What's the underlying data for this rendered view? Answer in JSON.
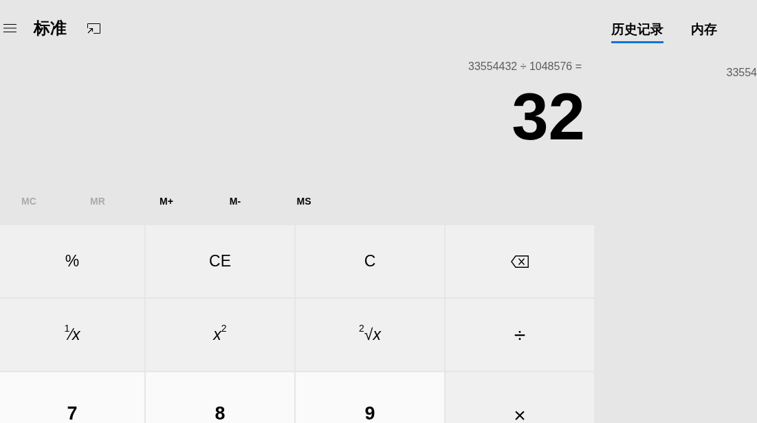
{
  "header": {
    "mode_title": "标准"
  },
  "display": {
    "expression": "33554432 ÷ 1048576 =",
    "result": "32"
  },
  "memory_buttons": [
    {
      "label": "MC",
      "disabled": true
    },
    {
      "label": "MR",
      "disabled": true
    },
    {
      "label": "M+",
      "disabled": false
    },
    {
      "label": "M-",
      "disabled": false
    },
    {
      "label": "MS",
      "disabled": false
    }
  ],
  "keys": [
    {
      "kind": "function",
      "label": "%"
    },
    {
      "kind": "function",
      "label": "CE"
    },
    {
      "kind": "function",
      "label": "C"
    },
    {
      "kind": "backspace"
    },
    {
      "kind": "function",
      "label": "$^{1}$⁄*x*"
    },
    {
      "kind": "function",
      "label": "*x*$^{2}$"
    },
    {
      "kind": "function",
      "label": "$^{2}$√*x*"
    },
    {
      "kind": "operator",
      "label": "÷"
    },
    {
      "kind": "digit",
      "label": "7"
    },
    {
      "kind": "digit",
      "label": "8"
    },
    {
      "kind": "digit",
      "label": "9"
    },
    {
      "kind": "operator",
      "label": "×"
    }
  ],
  "tabs": [
    {
      "label": "历史记录",
      "selected": true
    },
    {
      "label": "内存",
      "selected": false
    }
  ],
  "history": [
    {
      "text": "33554"
    }
  ]
}
